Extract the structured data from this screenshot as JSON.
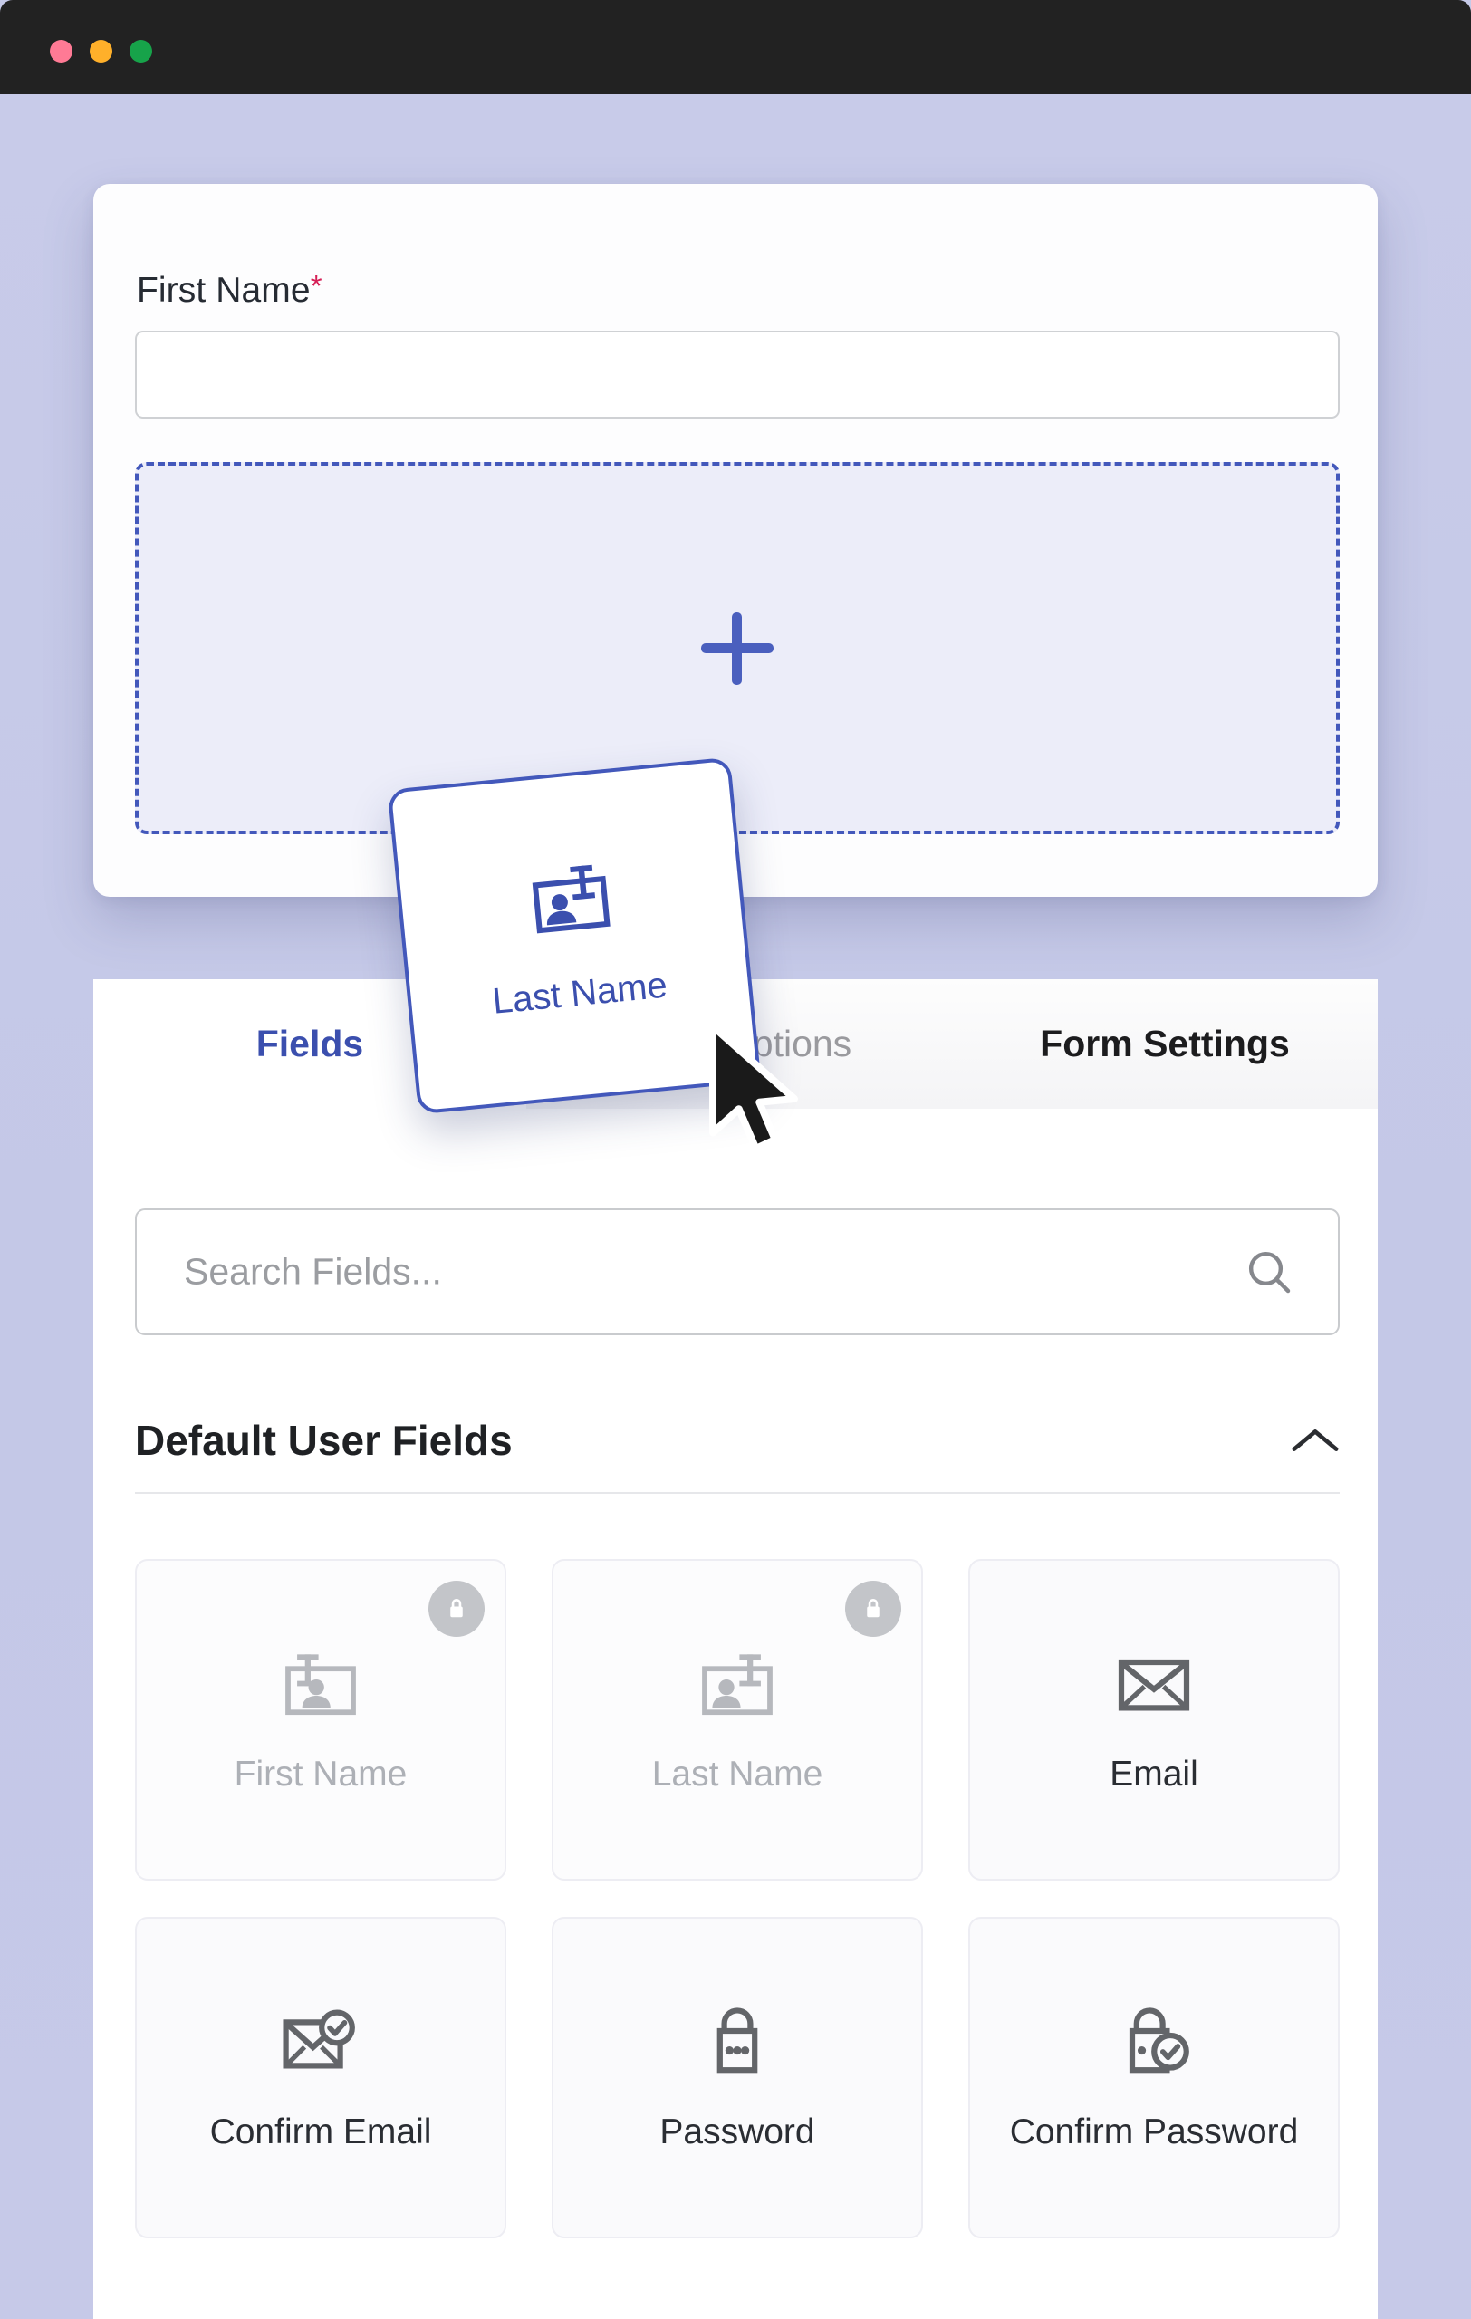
{
  "window": {
    "traffic_lights": [
      "close",
      "minimize",
      "zoom"
    ],
    "colors": {
      "close": "#ff7a95",
      "minimize": "#ffb02a",
      "zoom": "#17a34a",
      "titlebar": "#222222",
      "page_background": "#c6cae8",
      "accent": "#4358bb",
      "required_star": "#d61f56"
    }
  },
  "form_preview": {
    "field_label": "First Name",
    "required_marker": "*",
    "input_value": "",
    "dropzone": {
      "icon": "plus-icon",
      "hint": ""
    }
  },
  "drag_ghost": {
    "label": "Last Name",
    "icon": "id-badge-icon"
  },
  "panel": {
    "tabs": [
      {
        "label": "Fields",
        "active": true
      },
      {
        "label": "Form Options",
        "active": false
      },
      {
        "label": "Form Settings",
        "active": false
      }
    ],
    "search": {
      "placeholder": "Search Fields...",
      "value": "",
      "icon": "search-icon"
    },
    "section": {
      "title": "Default User Fields",
      "collapse_icon": "chevron-up-icon",
      "expanded": true
    },
    "fields": [
      {
        "label": "First Name",
        "icon": "id-badge-icon",
        "locked": true,
        "lock_icon": "lock-icon"
      },
      {
        "label": "Last Name",
        "icon": "id-badge-icon",
        "locked": true,
        "lock_icon": "lock-icon"
      },
      {
        "label": "Email",
        "icon": "envelope-icon",
        "locked": false
      },
      {
        "label": "Confirm Email",
        "icon": "envelope-check-icon",
        "locked": false
      },
      {
        "label": "Password",
        "icon": "padlock-dots-icon",
        "locked": false
      },
      {
        "label": "Confirm Password",
        "icon": "padlock-check-icon",
        "locked": false
      }
    ]
  },
  "cursor": {
    "type": "arrow-pointer"
  }
}
